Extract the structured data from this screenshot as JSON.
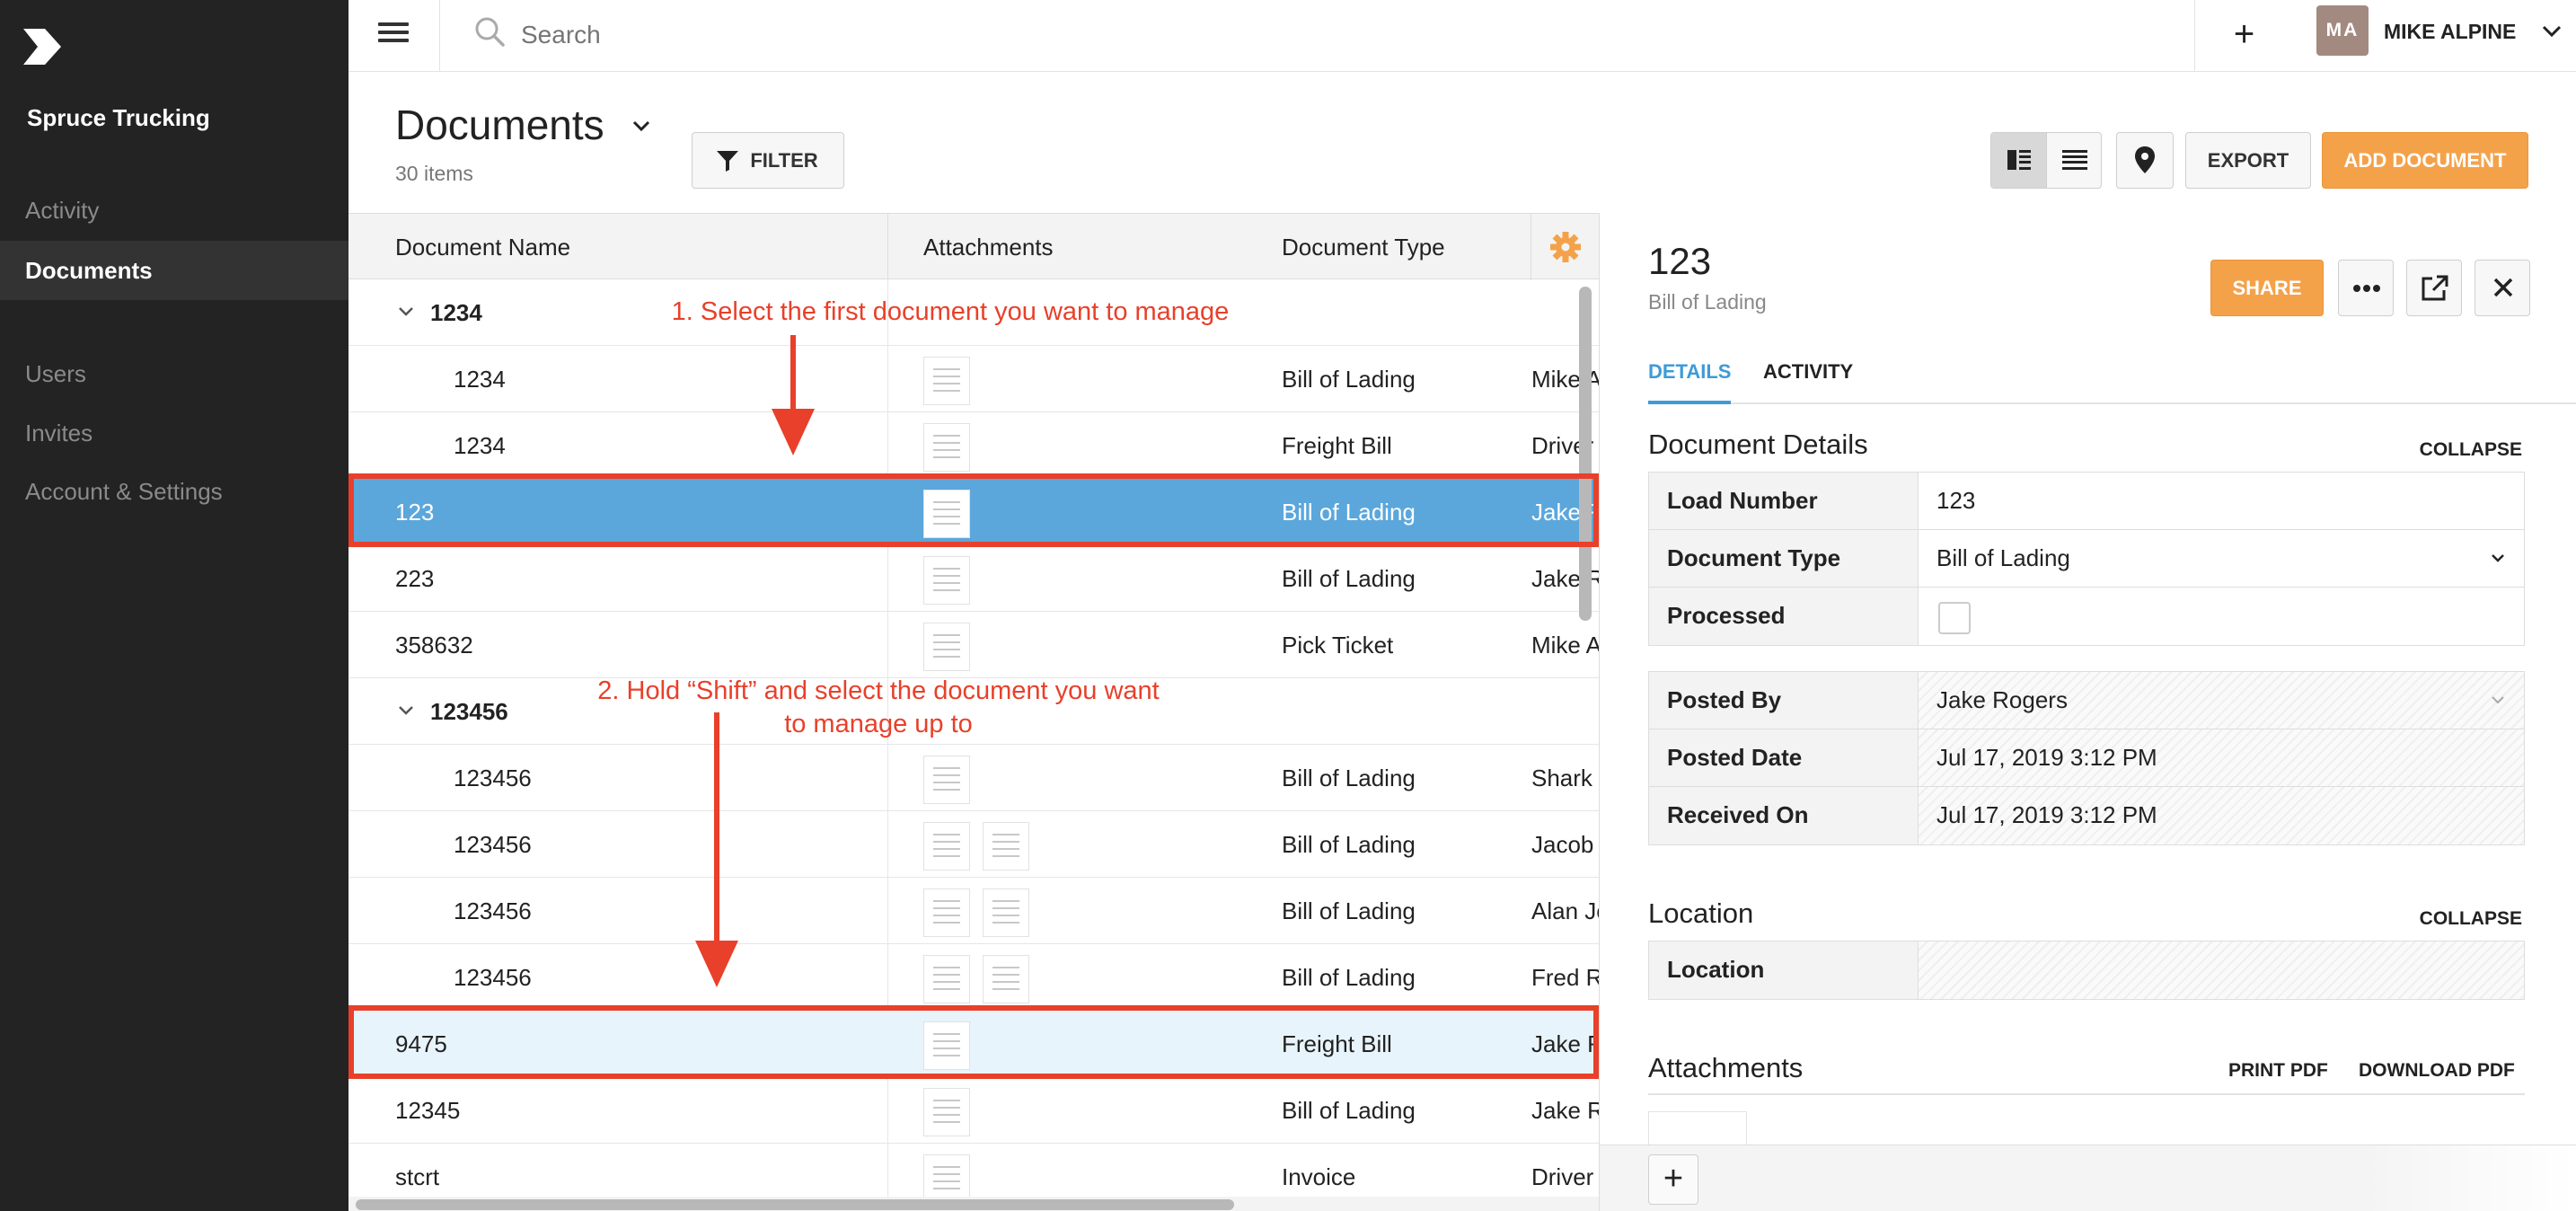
{
  "app": {
    "company": "Spruce Trucking",
    "brand_color": "#232323",
    "accent_color": "#f4a24a",
    "selection_color": "#5ba7dc"
  },
  "sidebar": {
    "items": [
      {
        "label": "Activity",
        "active": false
      },
      {
        "label": "Documents",
        "active": true
      },
      {
        "label": "Users",
        "active": false
      },
      {
        "label": "Invites",
        "active": false
      },
      {
        "label": "Account & Settings",
        "active": false
      }
    ]
  },
  "topbar": {
    "search_placeholder": "Search",
    "user_initials": "MA",
    "user_name": "MIKE ALPINE"
  },
  "page": {
    "title": "Documents",
    "item_count": "30 items",
    "filter_label": "FILTER",
    "export_label": "EXPORT",
    "add_document_label": "ADD DOCUMENT"
  },
  "table": {
    "columns": [
      "Document Name",
      "Attachments",
      "Document Type"
    ],
    "rows": [
      {
        "kind": "group",
        "name": "1234"
      },
      {
        "kind": "child",
        "name": "1234",
        "type": "Bill of Lading",
        "extra": "Mike A",
        "thumbs": 1
      },
      {
        "kind": "child",
        "name": "1234",
        "type": "Freight Bill",
        "extra": "Driver",
        "thumbs": 1
      },
      {
        "kind": "row",
        "name": "123",
        "type": "Bill of Lading",
        "extra": "Jake R",
        "thumbs": 1,
        "state": "selected"
      },
      {
        "kind": "row",
        "name": "223",
        "type": "Bill of Lading",
        "extra": "Jake R",
        "thumbs": 1
      },
      {
        "kind": "row",
        "name": "358632",
        "type": "Pick Ticket",
        "extra": "Mike A",
        "thumbs": 1
      },
      {
        "kind": "group",
        "name": "123456"
      },
      {
        "kind": "child",
        "name": "123456",
        "type": "Bill of Lading",
        "extra": "Shark",
        "thumbs": 1
      },
      {
        "kind": "child",
        "name": "123456",
        "type": "Bill of Lading",
        "extra": "Jacob",
        "thumbs": 2
      },
      {
        "kind": "child",
        "name": "123456",
        "type": "Bill of Lading",
        "extra": "Alan Je",
        "thumbs": 2
      },
      {
        "kind": "child",
        "name": "123456",
        "type": "Bill of Lading",
        "extra": "Fred R",
        "thumbs": 2
      },
      {
        "kind": "row",
        "name": "9475",
        "type": "Freight Bill",
        "extra": "Jake R",
        "thumbs": 1,
        "state": "selected2"
      },
      {
        "kind": "row",
        "name": "12345",
        "type": "Bill of Lading",
        "extra": "Jake R",
        "thumbs": 1
      },
      {
        "kind": "row",
        "name": "stcrt",
        "type": "Invoice",
        "extra": "Driver",
        "thumbs": 1
      }
    ]
  },
  "annotations": {
    "step1": "1. Select the first document you want to manage",
    "step2_line1": "2. Hold “Shift” and select the document you want",
    "step2_line2": "to manage up to",
    "color": "#e8402a"
  },
  "detail": {
    "title": "123",
    "subtitle": "Bill of Lading",
    "share_label": "SHARE",
    "tabs": [
      "DETAILS",
      "ACTIVITY"
    ],
    "document_details_title": "Document Details",
    "collapse_label": "COLLAPSE",
    "fields": [
      {
        "key": "Load Number",
        "value": "123"
      },
      {
        "key": "Document Type",
        "value": "Bill of Lading"
      },
      {
        "key": "Processed",
        "value": ""
      }
    ],
    "meta": [
      {
        "key": "Posted By",
        "value": "Jake Rogers"
      },
      {
        "key": "Posted Date",
        "value": "Jul 17, 2019 3:12 PM"
      },
      {
        "key": "Received On",
        "value": "Jul 17, 2019 3:12 PM"
      }
    ],
    "location_title": "Location",
    "location_key": "Location",
    "location_value": "",
    "attachments_title": "Attachments",
    "print_pdf_label": "PRINT PDF",
    "download_pdf_label": "DOWNLOAD PDF"
  }
}
